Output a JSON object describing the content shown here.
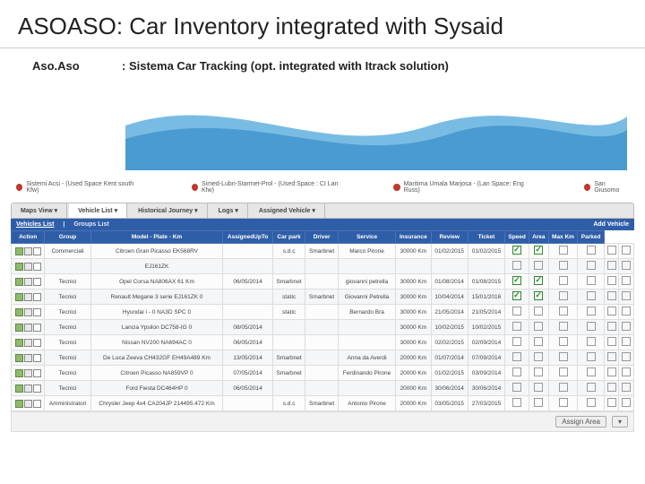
{
  "title": "ASOASO: Car Inventory integrated with Sysaid",
  "subtitle": {
    "label": "Aso.Aso",
    "desc": ": Sistema Car Tracking (opt. integrated with Itrack solution)"
  },
  "status": [
    {
      "text": "Sistemi Acsi - (Used Space Kent south Kfw)"
    },
    {
      "text": "Simed-Lubri-Starmet-Prol - (Used Space : CI Lan Kfw)"
    },
    {
      "text": "Maritima Umala Marjosa - (Lan Space: Eng Russ)"
    },
    {
      "text": "San Giusomo"
    }
  ],
  "tabs": [
    "Maps View ▾",
    "Vehicle List ▾",
    "Historical Journey ▾",
    "Logs ▾",
    "Assigned Vehicle ▾"
  ],
  "activeTab": 1,
  "subnav": {
    "items": [
      "Vehicles List",
      "Groups List"
    ],
    "active": 0,
    "add": "Add Vehicle"
  },
  "columns": [
    "Action",
    "Group",
    "Model - Plate - Km",
    "AssignedUpTo",
    "Car park",
    "Driver",
    "Service",
    "Insurance",
    "Review",
    "Ticket",
    "Speed",
    "Area",
    "Max Km",
    "Parked"
  ],
  "rows": [
    {
      "group": "Commerciali",
      "model": "Citroen Gran Picasso EK568RV",
      "up": "",
      "park": "s.d.c",
      "driver_park": "Smarbnet",
      "driver": "Marco Pirone",
      "service": "30000 Km",
      "ins": "01/02/2015",
      "rev": "01/02/2015",
      "flags": [
        true,
        true,
        false,
        false,
        false,
        false
      ]
    },
    {
      "group": "",
      "model": "EJ161ZK",
      "up": "",
      "park": "",
      "driver_park": "",
      "driver": "",
      "service": "",
      "ins": "",
      "rev": "",
      "flags": [
        false,
        false,
        false,
        false,
        false,
        false
      ]
    },
    {
      "group": "Tecnici",
      "model": "Opel Corsa NA806AX 61 Km",
      "up": "06/05/2014",
      "park": "Smarbnet",
      "driver_park": "",
      "driver": "giovanni petrella",
      "service": "30000 Km",
      "ins": "01/08/2014",
      "rev": "01/08/2015",
      "flags": [
        true,
        true,
        false,
        false,
        false,
        false
      ]
    },
    {
      "group": "Tecnici",
      "model": "Renault Megane 3 serie EJ161ZK 0",
      "up": "",
      "park": "static",
      "driver_park": "Smarbnet",
      "driver": "Giovanni Petrella",
      "service": "30000 Km",
      "ins": "10/04/2014",
      "rev": "15/01/2016",
      "flags": [
        true,
        true,
        false,
        false,
        false,
        false
      ]
    },
    {
      "group": "Tecnici",
      "model": "Hyundai i - 0 NA3D SPC 0",
      "up": "",
      "park": "static",
      "driver_park": "",
      "driver": "Bernardo Bra",
      "service": "30000 Km",
      "ins": "21/05/2014",
      "rev": "21/05/2014",
      "flags": [
        false,
        false,
        false,
        false,
        false,
        false
      ]
    },
    {
      "group": "Tecnici",
      "model": "Lancia Ypsilon DC758-IG 0",
      "up": "08/05/2014",
      "park": "",
      "driver_park": "",
      "driver": "",
      "service": "30000 Km",
      "ins": "10/02/2015",
      "rev": "10/02/2015",
      "flags": [
        false,
        false,
        false,
        false,
        false,
        false
      ]
    },
    {
      "group": "Tecnici",
      "model": "Nissan NV200 NA694AC 0",
      "up": "06/05/2014",
      "park": "",
      "driver_park": "",
      "driver": "",
      "service": "30000 Km",
      "ins": "02/02/2015",
      "rev": "02/09/2014",
      "flags": [
        false,
        false,
        false,
        false,
        false,
        false
      ]
    },
    {
      "group": "Tecnici",
      "model": "De Luca Zeeva CH432GF EH49A489 Km",
      "up": "13/05/2014",
      "park": "Smarbnet",
      "driver_park": "",
      "driver": "Anna da Averdi",
      "service": "20000 Km",
      "ins": "01/07/2014",
      "rev": "07/09/2014",
      "flags": [
        false,
        false,
        false,
        false,
        false,
        false
      ]
    },
    {
      "group": "Tecnici",
      "model": "Citroen Picasso NA859VP 0",
      "up": "07/05/2014",
      "park": "Smarbnet",
      "driver_park": "",
      "driver": "Ferdinando Pirone",
      "service": "20000 Km",
      "ins": "01/02/2015",
      "rev": "03/09/2014",
      "flags": [
        false,
        false,
        false,
        false,
        false,
        false
      ]
    },
    {
      "group": "Tecnici",
      "model": "Ford Fiesta DC464HP 0",
      "up": "06/05/2014",
      "park": "",
      "driver_park": "",
      "driver": "",
      "service": "20000 Km",
      "ins": "30/06/2014",
      "rev": "30/06/2014",
      "flags": [
        false,
        false,
        false,
        false,
        false,
        false
      ]
    },
    {
      "group": "Amministratori",
      "model": "Chrysler Jeep 4x4 CA204JP 214495.472 Km",
      "up": "",
      "park": "s.d.c",
      "driver_park": "Smarbnet",
      "driver": "Antonio Pirone",
      "service": "20000 Km",
      "ins": "03/05/2015",
      "rev": "27/03/2015",
      "flags": [
        false,
        false,
        false,
        false,
        false,
        false
      ]
    }
  ],
  "footer": {
    "label": "Assign Area",
    "opts": "▾"
  }
}
